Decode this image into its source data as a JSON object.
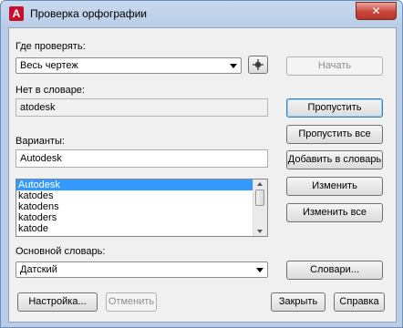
{
  "window": {
    "title": "Проверка орфографии",
    "close_glyph": "✕"
  },
  "where_to_check": {
    "label": "Где проверять:",
    "value": "Весь чертеж",
    "start_button": "Начать"
  },
  "not_in_dictionary": {
    "label": "Нет в словаре:",
    "word": "atodesk"
  },
  "suggestions": {
    "label": "Варианты:",
    "value": "Autodesk",
    "items": [
      "Autodesk",
      "katodes",
      "katodens",
      "katoders",
      "katode"
    ],
    "selected_index": 0
  },
  "main_dictionary": {
    "label": "Основной словарь:",
    "value": "Датский"
  },
  "buttons": {
    "ignore": "Пропустить",
    "ignore_all": "Пропустить все",
    "add_to_dictionary": "Добавить в словарь",
    "change": "Изменить",
    "change_all": "Изменить все",
    "dictionaries": "Словари...",
    "settings": "Настройка...",
    "undo": "Отменить",
    "close": "Закрыть",
    "help": "Справка"
  }
}
